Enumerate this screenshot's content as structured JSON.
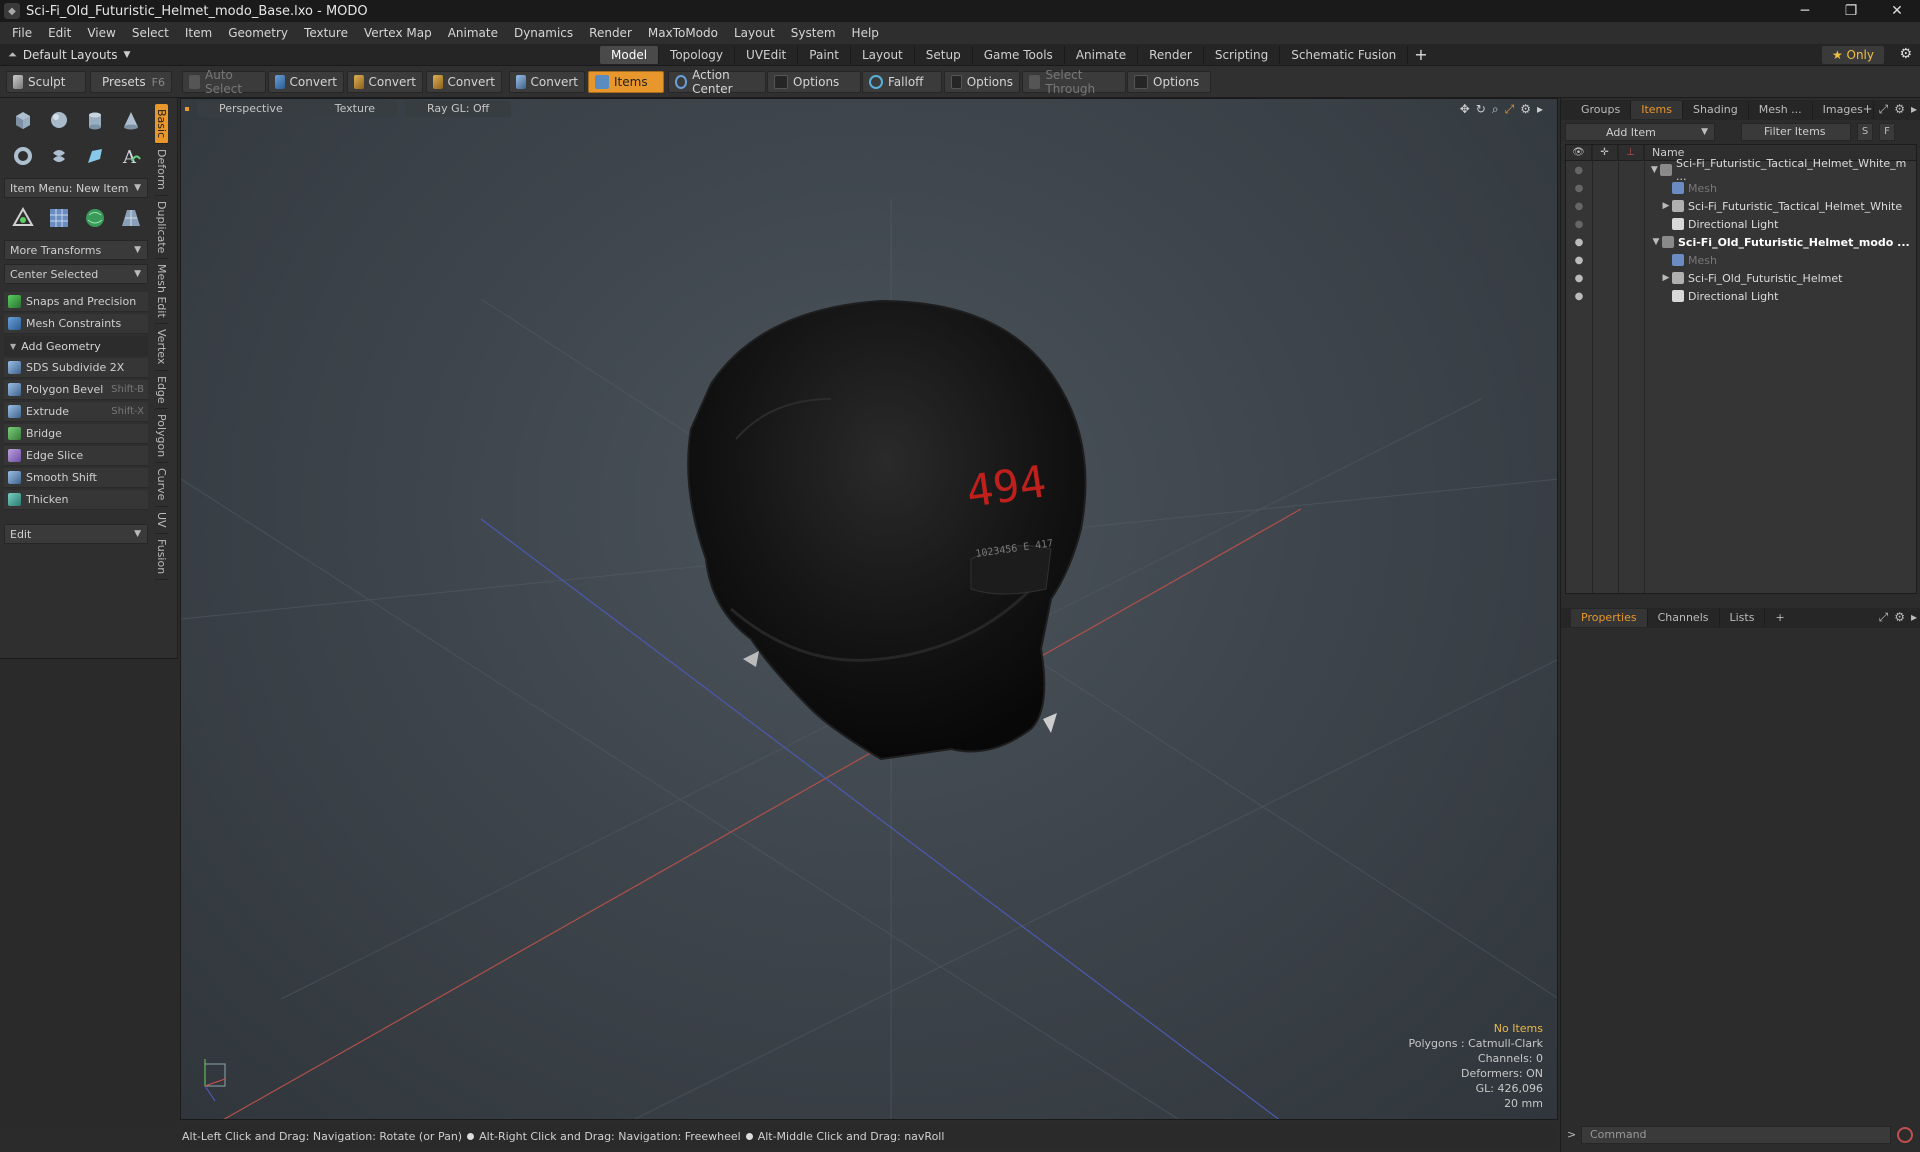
{
  "window": {
    "title": "Sci-Fi_Old_Futuristic_Helmet_modo_Base.lxo - MODO",
    "minimize": "─",
    "maximize": "❐",
    "close": "✕"
  },
  "menubar": [
    "File",
    "Edit",
    "View",
    "Select",
    "Item",
    "Geometry",
    "Texture",
    "Vertex Map",
    "Animate",
    "Dynamics",
    "Render",
    "MaxToModo",
    "Layout",
    "System",
    "Help"
  ],
  "layoutbar": {
    "layouts_label": "Default Layouts",
    "tabs": [
      "Model",
      "Topology",
      "UVEdit",
      "Paint",
      "Layout",
      "Setup",
      "Game Tools",
      "Animate",
      "Render",
      "Scripting",
      "Schematic Fusion"
    ],
    "active_tab": "Model",
    "plus": "+",
    "only_label": "★  Only"
  },
  "toolbar": {
    "sculpt": "Sculpt",
    "presets": "Presets",
    "presets_key": "F6",
    "auto_select": "Auto Select",
    "convert1": "Convert",
    "convert2": "Convert",
    "convert3": "Convert",
    "convert4": "Convert",
    "items": "Items",
    "action_center": "Action Center",
    "options1": "Options",
    "falloff": "Falloff",
    "options2": "Options",
    "select_through": "Select Through",
    "options3": "Options"
  },
  "leftpanel": {
    "item_menu": "Item Menu: New Item",
    "more_transforms": "More Transforms",
    "center_selected": "Center Selected",
    "snaps": "Snaps and Precision",
    "mesh_constraints": "Mesh Constraints",
    "add_geometry": "Add Geometry",
    "tools": [
      {
        "label": "SDS Subdivide 2X",
        "shortcut": ""
      },
      {
        "label": "Polygon Bevel",
        "shortcut": "Shift-B"
      },
      {
        "label": "Extrude",
        "shortcut": "Shift-X"
      },
      {
        "label": "Bridge",
        "shortcut": ""
      },
      {
        "label": "Edge Slice",
        "shortcut": ""
      },
      {
        "label": "Smooth Shift",
        "shortcut": ""
      },
      {
        "label": "Thicken",
        "shortcut": ""
      }
    ],
    "edit": "Edit",
    "side_tabs": [
      "Basic",
      "Deform",
      "Duplicate",
      "Mesh Edit",
      "Vertex",
      "Edge",
      "Polygon",
      "Curve",
      "UV",
      "Fusion"
    ]
  },
  "viewport": {
    "view_mode": "Perspective",
    "shading": "Texture",
    "raygl": "Ray GL: Off",
    "helmet_number": "494",
    "helmet_serial": "1023456 E 417",
    "info": {
      "no_items": "No Items",
      "polygons": "Polygons : Catmull-Clark",
      "channels": "Channels: 0",
      "deformers": "Deformers: ON",
      "gl": "GL: 426,096",
      "scale": "20 mm"
    }
  },
  "statusbar": {
    "hint1": "Alt-Left Click and Drag: Navigation: Rotate (or Pan)",
    "hint2": "Alt-Right Click and Drag: Navigation: Freewheel",
    "hint3": "Alt-Middle Click and Drag: navRoll"
  },
  "rightpanel": {
    "top_tabs": [
      "Groups",
      "Items",
      "Shading",
      "Mesh ...",
      "Images"
    ],
    "active_top_tab": "Items",
    "add_item": "Add Item",
    "filter_items": "Filter Items",
    "s_btn": "S",
    "f_btn": "F",
    "name_header": "Name",
    "tree": [
      {
        "name": "Sci-Fi_Futuristic_Tactical_Helmet_White_m ...",
        "level": 0,
        "expander": "▼",
        "style": "normal",
        "eye": "dim",
        "icon": "scene"
      },
      {
        "name": "Mesh",
        "level": 1,
        "expander": "",
        "style": "dim",
        "eye": "dim",
        "icon": "mesh"
      },
      {
        "name": "Sci-Fi_Futuristic_Tactical_Helmet_White",
        "level": 1,
        "expander": "▶",
        "style": "normal",
        "eye": "dim",
        "icon": "group"
      },
      {
        "name": "Directional Light",
        "level": 1,
        "expander": "",
        "style": "normal",
        "eye": "dim",
        "icon": "light"
      },
      {
        "name": "Sci-Fi_Old_Futuristic_Helmet_modo ...",
        "level": 0,
        "expander": "▼",
        "style": "bold",
        "eye": "on",
        "icon": "scene"
      },
      {
        "name": "Mesh",
        "level": 1,
        "expander": "",
        "style": "dim",
        "eye": "on",
        "icon": "mesh"
      },
      {
        "name": "Sci-Fi_Old_Futuristic_Helmet",
        "level": 1,
        "expander": "▶",
        "style": "normal",
        "eye": "on",
        "icon": "group"
      },
      {
        "name": "Directional Light",
        "level": 1,
        "expander": "",
        "style": "normal",
        "eye": "on",
        "icon": "light"
      }
    ],
    "bottom_tabs": [
      "Properties",
      "Channels",
      "Lists"
    ],
    "active_bottom_tab": "Properties",
    "command_placeholder": "Command"
  }
}
